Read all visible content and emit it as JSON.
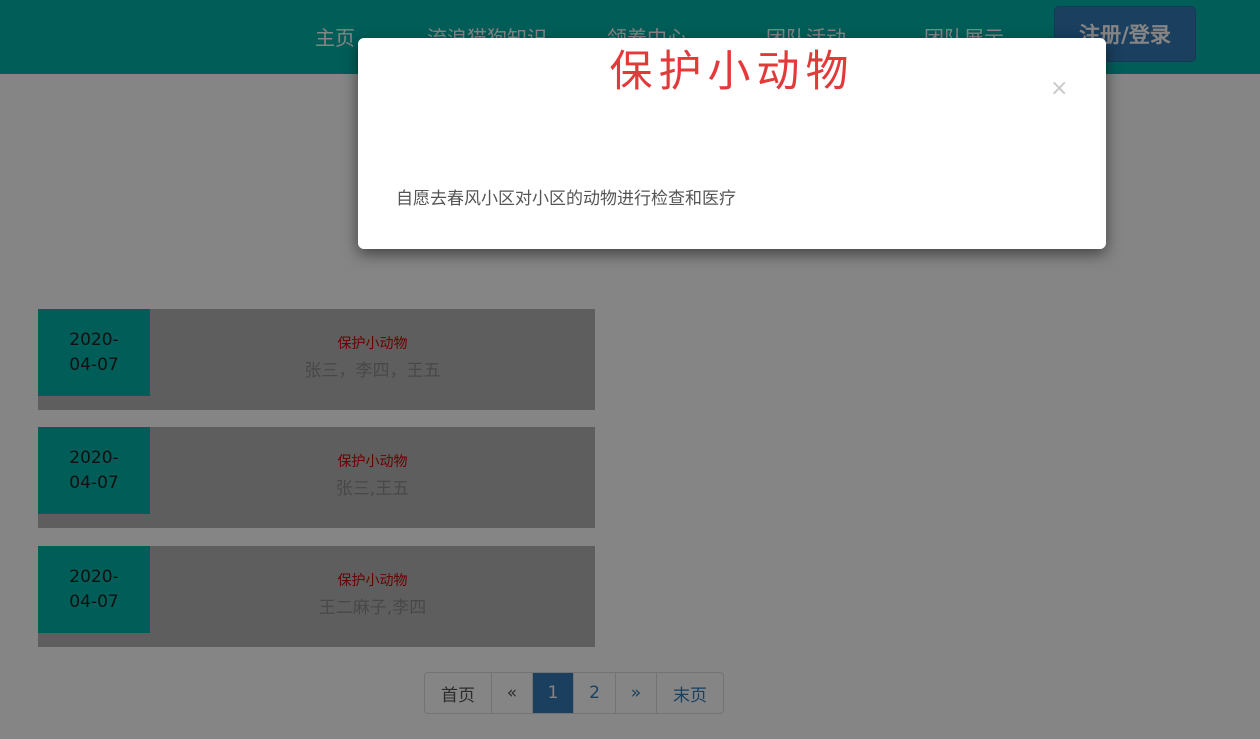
{
  "nav": {
    "items": [
      {
        "label": "主页"
      },
      {
        "label": "流浪猫狗知识"
      },
      {
        "label": "领养中心"
      },
      {
        "label": "团队活动"
      },
      {
        "label": "团队展示"
      }
    ],
    "login_label": "注册/登录"
  },
  "activities": [
    {
      "date_line1": "2020-",
      "date_line2": "04-07",
      "title": "保护小动物",
      "members": "张三，李四，王五"
    },
    {
      "date_line1": "2020-",
      "date_line2": "04-07",
      "title": "保护小动物",
      "members": "张三,王五"
    },
    {
      "date_line1": "2020-",
      "date_line2": "04-07",
      "title": "保护小动物",
      "members": "王二麻子,李四"
    }
  ],
  "pagination": {
    "first": "首页",
    "prev": "«",
    "pages": [
      "1",
      "2"
    ],
    "current": "1",
    "next": "»",
    "last": "末页"
  },
  "modal": {
    "title": "保护小动物",
    "close": "×",
    "body": "自愿去春风小区对小区的动物进行检查和医疗"
  },
  "colors": {
    "brand": "#00b3aa",
    "primary": "#337ab7",
    "title_red": "#e23a3a"
  }
}
